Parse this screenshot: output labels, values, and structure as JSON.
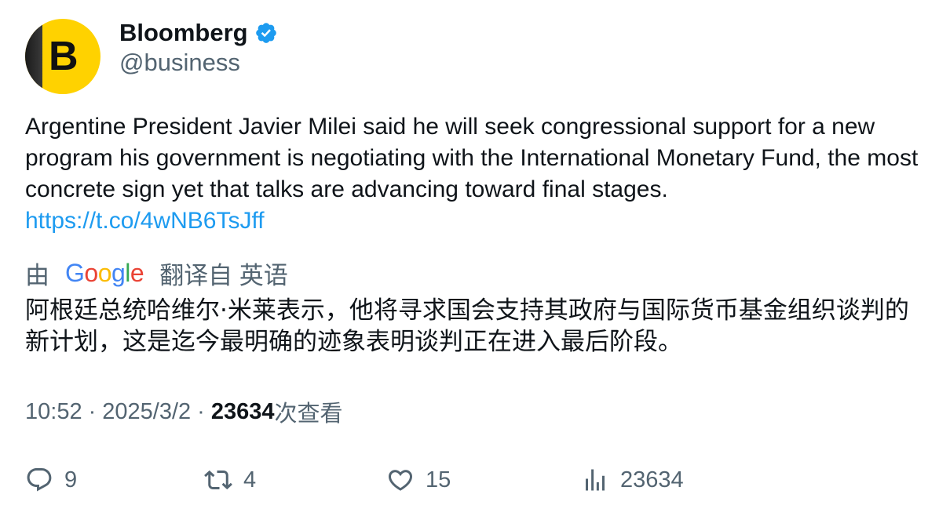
{
  "author": {
    "avatar_letter": "B",
    "display_name": "Bloomberg",
    "handle": "@business",
    "verified": true
  },
  "tweet": {
    "text": "Argentine President Javier Milei said he will seek congressional support for a new program his government is negotiating with the International Monetary Fund, the most concrete sign yet that talks are advancing toward final stages.",
    "link": "https://t.co/4wNB6TsJff"
  },
  "translation": {
    "prefix": "由",
    "provider_letters": [
      "G",
      "o",
      "o",
      "g",
      "l",
      "e"
    ],
    "suffix": "翻译自 英语",
    "text": "阿根廷总统哈维尔·米莱表示，他将寻求国会支持其政府与国际货币基金组织谈判的新计划，这是迄今最明确的迹象表明谈判正在进入最后阶段。"
  },
  "meta": {
    "time": "10:52",
    "separator": "·",
    "date": "2025/3/2",
    "views_count": "23634",
    "views_label": "次查看"
  },
  "actions": {
    "replies": "9",
    "retweets": "4",
    "likes": "15",
    "views": "23634"
  },
  "colors": {
    "link": "#1d9bf0",
    "secondary_text": "#536471",
    "primary_text": "#0f1419",
    "verified": "#1d9bf0",
    "avatar_bg": "#ffd200",
    "google": [
      "#4285F4",
      "#EA4335",
      "#FBBC05",
      "#4285F4",
      "#34A853",
      "#EA4335"
    ]
  }
}
